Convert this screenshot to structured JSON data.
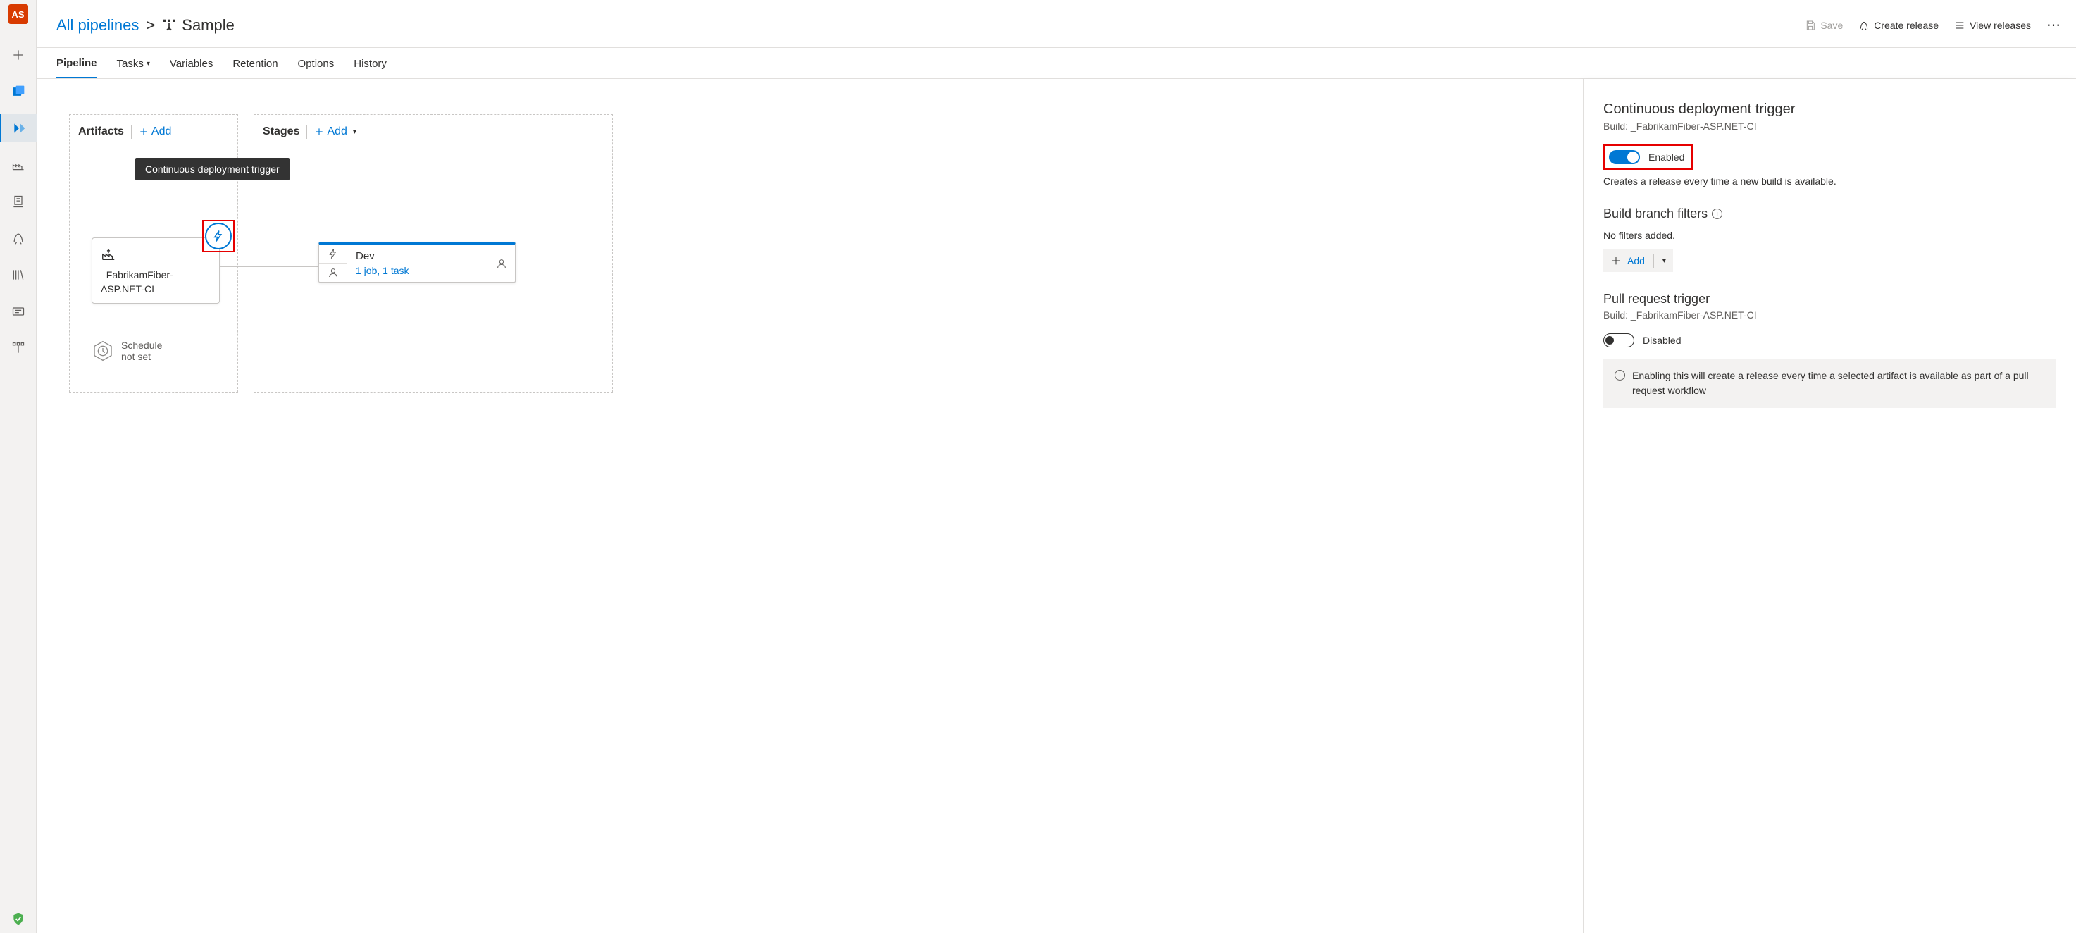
{
  "rail": {
    "avatar": "AS"
  },
  "breadcrumb": {
    "root": "All pipelines",
    "chevron": ">",
    "title": "Sample"
  },
  "header_actions": {
    "save": "Save",
    "create_release": "Create release",
    "view_releases": "View releases"
  },
  "tabs": {
    "pipeline": "Pipeline",
    "tasks": "Tasks",
    "variables": "Variables",
    "retention": "Retention",
    "options": "Options",
    "history": "History"
  },
  "canvas": {
    "artifacts_title": "Artifacts",
    "stages_title": "Stages",
    "add": "Add",
    "tooltip": "Continuous deployment trigger",
    "artifact_name": "_FabrikamFiber-ASP.NET-CI",
    "schedule_line1": "Schedule",
    "schedule_line2": "not set",
    "stage_name": "Dev",
    "stage_detail": "1 job, 1 task"
  },
  "panel": {
    "cd_title": "Continuous deployment trigger",
    "cd_build_label": "Build: _FabrikamFiber-ASP.NET-CI",
    "enabled": "Enabled",
    "cd_helper": "Creates a release every time a new build is available.",
    "filters_title": "Build branch filters",
    "no_filters": "No filters added.",
    "add": "Add",
    "pr_title": "Pull request trigger",
    "pr_build_label": "Build: _FabrikamFiber-ASP.NET-CI",
    "disabled": "Disabled",
    "pr_info": "Enabling this will create a release every time a selected artifact is available as part of a pull request workflow"
  }
}
